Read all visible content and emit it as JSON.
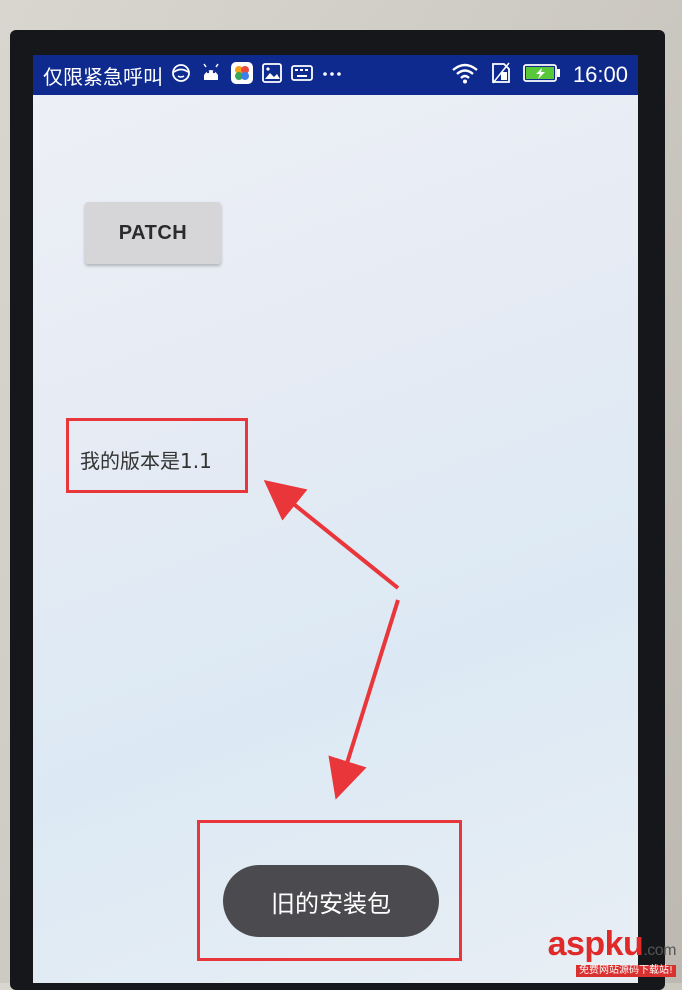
{
  "status_bar": {
    "carrier": "仅限紧急呼叫",
    "time": "16:00",
    "icons": [
      "notification-face-icon",
      "android-icon",
      "app-icon",
      "image-icon",
      "keyboard-icon",
      "more-dots-icon",
      "wifi-icon",
      "sim-icon",
      "battery-icon"
    ]
  },
  "main": {
    "patch_button_label": "PATCH",
    "version_text": "我的版本是1.1"
  },
  "toast": {
    "text": "旧的安装包"
  },
  "watermark": {
    "main": "aspku",
    "suffix": ".com",
    "sub": "免费网站源码下载站!"
  },
  "colors": {
    "status_bar": "#0f2a8e",
    "annotation": "#e8363a",
    "toast_bg": "#4a4a4f",
    "button_bg": "#d6d6d9"
  }
}
